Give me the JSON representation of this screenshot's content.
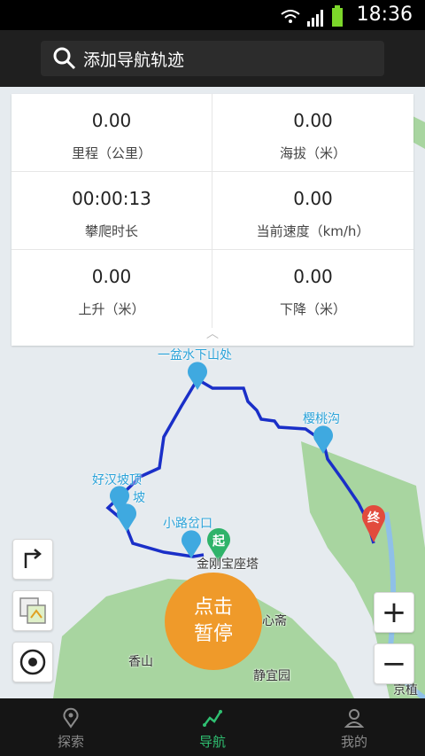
{
  "status_bar": {
    "time": "18:36"
  },
  "search": {
    "placeholder": "添加导航轨迹"
  },
  "stats": [
    {
      "value": "0.00",
      "label": "里程（公里）"
    },
    {
      "value": "0.00",
      "label": "海拔（米）"
    },
    {
      "value": "00:00:13",
      "label": "攀爬时长"
    },
    {
      "value": "0.00",
      "label": "当前速度（km/h）"
    },
    {
      "value": "0.00",
      "label": "上升（米）"
    },
    {
      "value": "0.00",
      "label": "下降（米）"
    }
  ],
  "map": {
    "waypoints": [
      "一盆水下山处",
      "樱桃沟",
      "好汉坡顶",
      "坡",
      "小路岔口"
    ],
    "start_marker": "起",
    "end_marker": "终",
    "places": [
      "金刚宝座塔",
      "心斋",
      "香山",
      "静宜园",
      "京植物"
    ]
  },
  "pause_button": {
    "line1": "点击",
    "line2": "暂停"
  },
  "zoom": {
    "in": "+",
    "out": "−"
  },
  "bottom_nav": [
    {
      "label": "探索",
      "icon": "location-pin-icon",
      "active": false
    },
    {
      "label": "导航",
      "icon": "route-zigzag-icon",
      "active": true
    },
    {
      "label": "我的",
      "icon": "person-icon",
      "active": false
    }
  ],
  "colors": {
    "active_tab": "#2fbf71",
    "inactive_tab": "#8a8a8a",
    "track": "#1a2fc8",
    "waypoint": "#3fa9e0",
    "pause": "#ef9a2a",
    "park_green": "#a8d5a0"
  }
}
